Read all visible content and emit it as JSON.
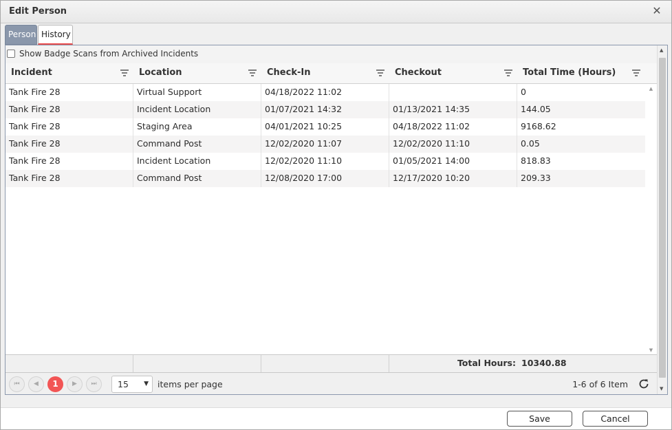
{
  "dialog": {
    "title": "Edit Person",
    "close_glyph": "✕"
  },
  "tabs": [
    {
      "label": "Person",
      "active": false
    },
    {
      "label": "History",
      "active": true
    }
  ],
  "archived_toggle": {
    "label": "Show Badge Scans from Archived Incidents",
    "checked": false
  },
  "grid": {
    "columns": [
      "Incident",
      "Location",
      "Check-In",
      "Checkout",
      "Total Time (Hours)"
    ],
    "rows": [
      [
        "Tank Fire 28",
        "Virtual Support",
        "04/18/2022 11:02",
        "",
        "0"
      ],
      [
        "Tank Fire 28",
        "Incident Location",
        "01/07/2021 14:32",
        "01/13/2021 14:35",
        "144.05"
      ],
      [
        "Tank Fire 28",
        "Staging Area",
        "04/01/2021 10:25",
        "04/18/2022 11:02",
        "9168.62"
      ],
      [
        "Tank Fire 28",
        "Command Post",
        "12/02/2020 11:07",
        "12/02/2020 11:10",
        "0.05"
      ],
      [
        "Tank Fire 28",
        "Incident Location",
        "12/02/2020 11:10",
        "01/05/2021 14:00",
        "818.83"
      ],
      [
        "Tank Fire 28",
        "Command Post",
        "12/08/2020 17:00",
        "12/17/2020 10:20",
        "209.33"
      ]
    ],
    "footer": {
      "total_label": "Total Hours:",
      "total_value": "10340.88"
    }
  },
  "pager": {
    "first_glyph": "⏮",
    "prev_glyph": "◀",
    "current_page": "1",
    "next_glyph": "▶",
    "last_glyph": "⏭",
    "page_size": "15",
    "caret_glyph": "▼",
    "items_per_page_label": "items per page",
    "info": "1-6 of 6 Item"
  },
  "buttons": {
    "save": "Save",
    "cancel": "Cancel"
  },
  "colors": {
    "active_tab_bg": "#8a97ab",
    "current_page_bg": "#f25555",
    "tab_underline": "#e94b4b"
  },
  "icons": {
    "filter": "filter-icon",
    "refresh": "refresh-icon",
    "close": "close-icon"
  }
}
